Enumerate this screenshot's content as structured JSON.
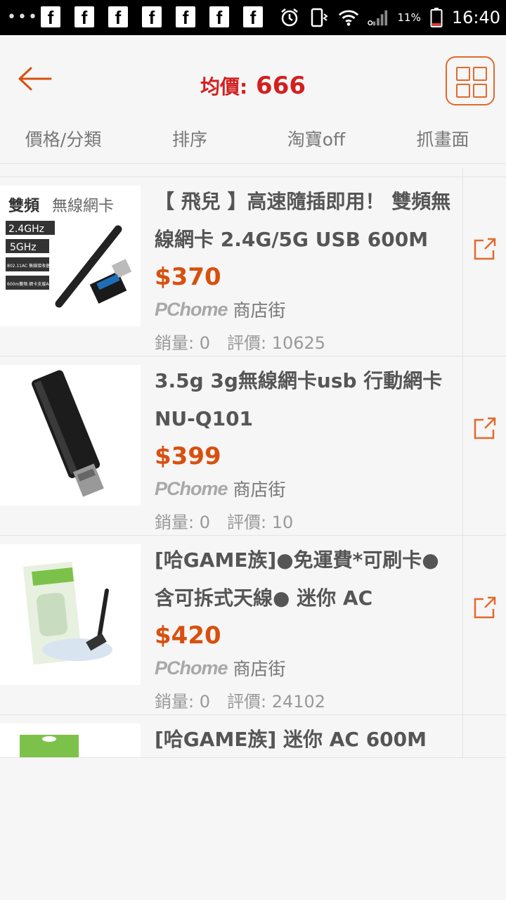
{
  "status_bar": {
    "clock": "16:40",
    "battery": "11%",
    "notification_icons": [
      "facebook-icon",
      "facebook-icon",
      "facebook-icon",
      "facebook-icon",
      "facebook-icon",
      "facebook-icon",
      "facebook-icon"
    ],
    "fb_glyph": "f"
  },
  "header": {
    "avg_label": "均價:",
    "avg_value": "666"
  },
  "tabs": [
    "價格/分類",
    "排序",
    "淘寶off",
    "抓畫面"
  ],
  "products": [
    {
      "title": "【 飛兒 】高速隨插即用！ 雙頻無線網卡 2.4G/5G USB 600M",
      "price": "$370",
      "store_logo": "PChome",
      "store": "商店街",
      "sales": "銷量: 0",
      "rating": "評價: 10625",
      "thumb_text": {
        "title_bold": "雙頻",
        "title_rest": "無線網卡",
        "tags": [
          "2.4GHz",
          "5GHz"
        ],
        "small": [
          "802.11AC 無線接收器",
          "600m雙頻 網卡支援AP"
        ]
      }
    },
    {
      "title": "3.5g 3g無線網卡usb 行動網卡NU-Q101",
      "price": "$399",
      "store_logo": "PChome",
      "store": "商店街",
      "sales": "銷量: 0",
      "rating": "評價: 10"
    },
    {
      "title": "[哈GAME族]●免運費*可刷卡●含可拆式天線● 迷你 AC",
      "price": "$420",
      "store_logo": "PChome",
      "store": "商店街",
      "sales": "銷量: 0",
      "rating": "評價: 24102"
    },
    {
      "title": "[哈GAME族] 迷你 AC 600M"
    }
  ],
  "colors": {
    "accent": "#d8500f",
    "avg_red": "#d31f1f",
    "icon_orange": "#e26a2c"
  }
}
